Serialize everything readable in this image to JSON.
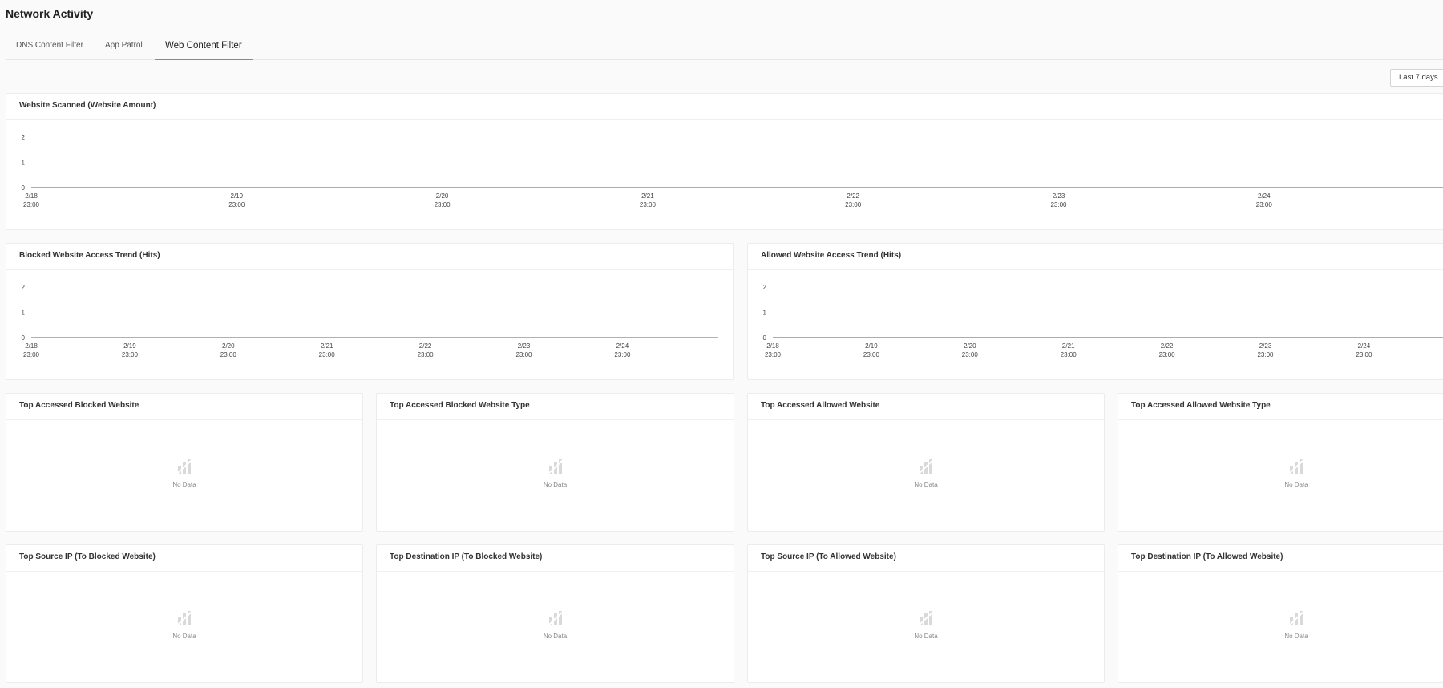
{
  "page_title": "Network Activity",
  "tabs": [
    {
      "label": "DNS Content Filter",
      "active": false
    },
    {
      "label": "App Patrol",
      "active": false
    },
    {
      "label": "Web Content Filter",
      "active": true
    }
  ],
  "time_range": "Last 7 days",
  "colors": {
    "accent": "#3aa0e0",
    "blocked_line": "#c0392b",
    "allowed_line": "#2e5fa8"
  },
  "trend_cards": {
    "scanned": {
      "title": "Website Scanned (Website Amount)"
    },
    "blocked": {
      "title": "Blocked Website Access Trend (Hits)"
    },
    "allowed": {
      "title": "Allowed Website Access Trend (Hits)"
    }
  },
  "empty_cards": [
    {
      "title": "Top Accessed Blocked Website",
      "message": "No Data"
    },
    {
      "title": "Top Accessed Blocked Website Type",
      "message": "No Data"
    },
    {
      "title": "Top Accessed Allowed Website",
      "message": "No Data"
    },
    {
      "title": "Top Accessed Allowed Website Type",
      "message": "No Data"
    },
    {
      "title": "Top Source IP (To Blocked Website)",
      "message": "No Data"
    },
    {
      "title": "Top Destination IP (To Blocked Website)",
      "message": "No Data"
    },
    {
      "title": "Top Source IP (To Allowed Website)",
      "message": "No Data"
    },
    {
      "title": "Top Destination IP (To Allowed Website)",
      "message": "No Data"
    }
  ],
  "chart_data": [
    {
      "type": "line",
      "title": "Website Scanned (Website Amount)",
      "x": [
        "2/18 23:00",
        "2/19 23:00",
        "2/20 23:00",
        "2/21 23:00",
        "2/22 23:00",
        "2/23 23:00",
        "2/24 23:00"
      ],
      "yticks": [
        0,
        1,
        2
      ],
      "ylim": [
        0,
        2
      ],
      "series": [
        {
          "values": [
            0,
            0,
            0,
            0,
            0,
            0,
            0
          ],
          "color": "#2e5fa8"
        }
      ]
    },
    {
      "type": "line",
      "title": "Blocked Website Access Trend (Hits)",
      "x": [
        "2/18 23:00",
        "2/19 23:00",
        "2/20 23:00",
        "2/21 23:00",
        "2/22 23:00",
        "2/23 23:00",
        "2/24 23:00"
      ],
      "yticks": [
        0,
        1,
        2
      ],
      "ylim": [
        0,
        2
      ],
      "series": [
        {
          "values": [
            0,
            0,
            0,
            0,
            0,
            0,
            0
          ],
          "color": "#c0392b"
        }
      ]
    },
    {
      "type": "line",
      "title": "Allowed Website Access Trend (Hits)",
      "x": [
        "2/18 23:00",
        "2/19 23:00",
        "2/20 23:00",
        "2/21 23:00",
        "2/22 23:00",
        "2/23 23:00",
        "2/24 23:00"
      ],
      "yticks": [
        0,
        1,
        2
      ],
      "ylim": [
        0,
        2
      ],
      "series": [
        {
          "values": [
            0,
            0,
            0,
            0,
            0,
            0,
            0
          ],
          "color": "#2e5fa8"
        }
      ]
    }
  ]
}
